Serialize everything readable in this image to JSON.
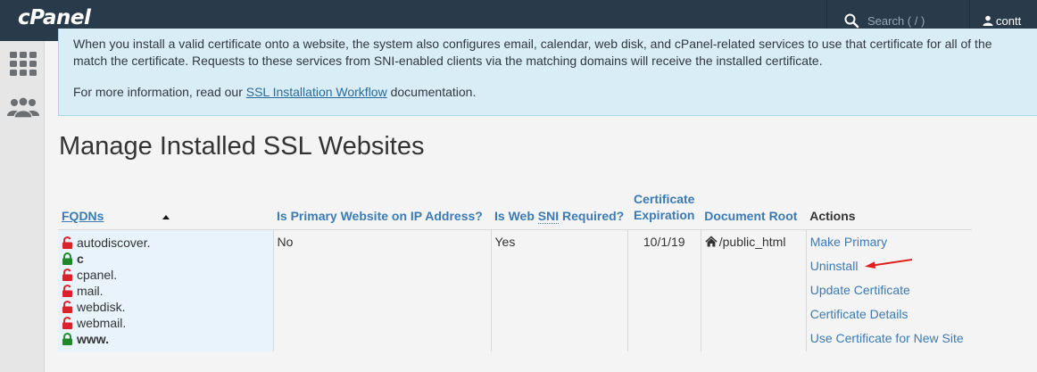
{
  "header": {
    "logo": "cPanel",
    "search_placeholder": "Search ( / )",
    "username": "contt"
  },
  "info": {
    "line1": "When you install a valid certificate onto a website, the system also configures email, calendar, web disk, and cPanel-related services to use that certificate for all of the",
    "line2": "match the certificate. Requests to these services from SNI-enabled clients via the matching domains will receive the installed certificate.",
    "more_prefix": "For more information, read our ",
    "more_link": "SSL Installation Workflow",
    "more_suffix": " documentation."
  },
  "page_title": "Manage Installed SSL Websites",
  "table": {
    "headers": {
      "fqdns": "FQDNs",
      "primary": "Is Primary Website on IP Address?",
      "sni_prefix": "Is Web ",
      "sni_abbr": "SNI",
      "sni_suffix": " Required?",
      "expiration_line1": "Certificate",
      "expiration_line2": "Expiration",
      "docroot": "Document Root",
      "actions": "Actions"
    },
    "row": {
      "fqdns": [
        {
          "name": "autodiscover.",
          "secure": false
        },
        {
          "name": "c",
          "secure": true
        },
        {
          "name": "cpanel.",
          "secure": false
        },
        {
          "name": "mail.",
          "secure": false
        },
        {
          "name": "webdisk.",
          "secure": false
        },
        {
          "name": "webmail.",
          "secure": false
        },
        {
          "name": "www.",
          "secure": true
        }
      ],
      "primary": "No",
      "sni": "Yes",
      "expiration": "10/1/19",
      "docroot": "/public_html",
      "actions": {
        "make_primary": "Make Primary",
        "uninstall": "Uninstall",
        "update": "Update Certificate",
        "details": "Certificate Details",
        "use_new": "Use Certificate for New Site"
      }
    }
  },
  "colors": {
    "topbar": "#293a4a",
    "link": "#3c7ab3",
    "lock_insecure": "#d9222a",
    "lock_secure": "#1e8a27",
    "annotation_arrow": "#e0201f"
  }
}
